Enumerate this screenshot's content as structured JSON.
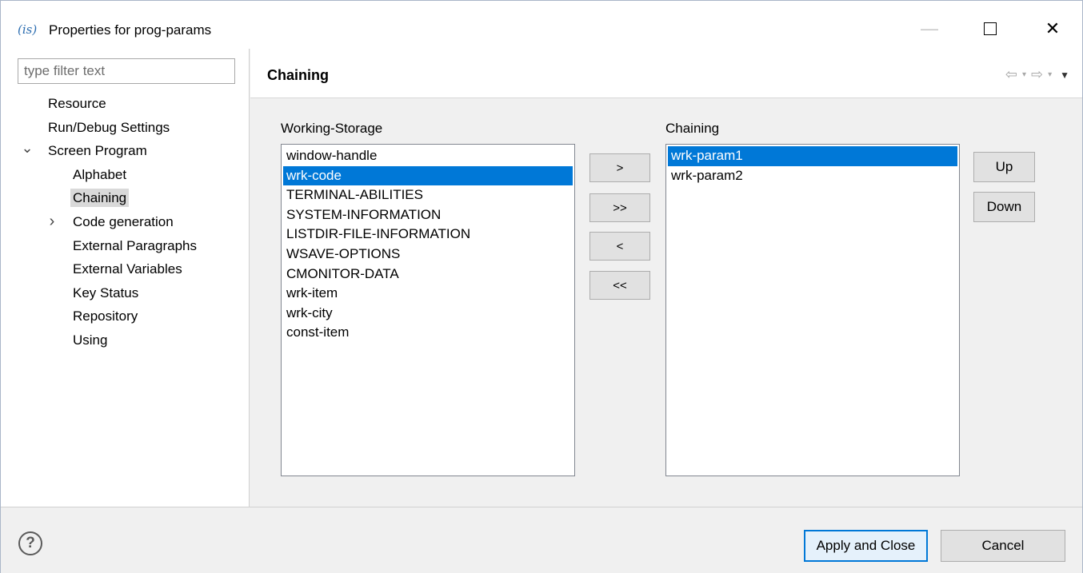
{
  "window": {
    "icon_text": "is",
    "title": "Properties for prog-params",
    "minimize": "—",
    "close": "✕"
  },
  "filter": {
    "placeholder": "type filter text",
    "value": ""
  },
  "tree": [
    {
      "label": "Resource",
      "level": 0,
      "expander": ""
    },
    {
      "label": "Run/Debug Settings",
      "level": 0,
      "expander": ""
    },
    {
      "label": "Screen Program",
      "level": 0,
      "expander": "expanded"
    },
    {
      "label": "Alphabet",
      "level": 1,
      "expander": ""
    },
    {
      "label": "Chaining",
      "level": 1,
      "expander": "",
      "selected": true
    },
    {
      "label": "Code generation",
      "level": 1,
      "expander": "collapsed"
    },
    {
      "label": "External Paragraphs",
      "level": 1,
      "expander": ""
    },
    {
      "label": "External Variables",
      "level": 1,
      "expander": ""
    },
    {
      "label": "Key Status",
      "level": 1,
      "expander": ""
    },
    {
      "label": "Repository",
      "level": 1,
      "expander": ""
    },
    {
      "label": "Using",
      "level": 1,
      "expander": ""
    }
  ],
  "page": {
    "title": "Chaining",
    "nav": {
      "back": "⇦",
      "forward": "⇨",
      "dropdown": "▾",
      "menu": "▼"
    }
  },
  "working_storage": {
    "label": "Working-Storage",
    "items": [
      "window-handle",
      "wrk-code",
      "TERMINAL-ABILITIES",
      "SYSTEM-INFORMATION",
      "LISTDIR-FILE-INFORMATION",
      "WSAVE-OPTIONS",
      "CMONITOR-DATA",
      "wrk-item",
      "wrk-city",
      "const-item"
    ],
    "selected": "wrk-code"
  },
  "chaining_list": {
    "label": "Chaining",
    "items": [
      "wrk-param1",
      "wrk-param2"
    ],
    "selected": "wrk-param1"
  },
  "move_buttons": {
    "add": ">",
    "add_all": ">>",
    "remove": "<",
    "remove_all": "<<"
  },
  "order_buttons": {
    "up": "Up",
    "down": "Down"
  },
  "footer": {
    "help": "?",
    "apply_close": "Apply and Close",
    "cancel": "Cancel"
  },
  "colors": {
    "selection": "#0078d7",
    "tree_selection": "#d9d9d9"
  }
}
